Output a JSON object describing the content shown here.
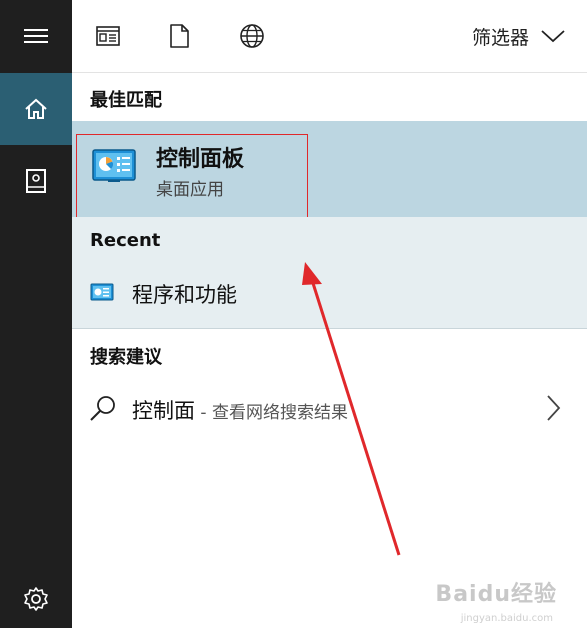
{
  "rail": {
    "icons": [
      "hamburger-menu-icon",
      "home-icon",
      "notebook-icon",
      "settings-gear-icon"
    ],
    "active_color": "#2b5f73",
    "background": "#1f1f1f"
  },
  "toolbar": {
    "icons": [
      "apps-icon",
      "documents-icon",
      "web-globe-icon"
    ],
    "filter_label": "筛选器"
  },
  "best_match": {
    "section_label": "最佳匹配",
    "title": "控制面板",
    "subtitle": "桌面应用",
    "highlight_color": "#bcd6e1"
  },
  "recent": {
    "section_label": "Recent",
    "items": [
      {
        "label": "程序和功能",
        "icon": "control-panel-icon"
      }
    ]
  },
  "suggestions": {
    "section_label": "搜索建议",
    "items": [
      {
        "query": "控制面",
        "hint": " - 查看网络搜索结果",
        "icon": "search-icon"
      }
    ]
  },
  "watermark": {
    "text": "Baidu经验",
    "sub": "jingyan.baidu.com"
  },
  "annotation_color": "#e0282b"
}
